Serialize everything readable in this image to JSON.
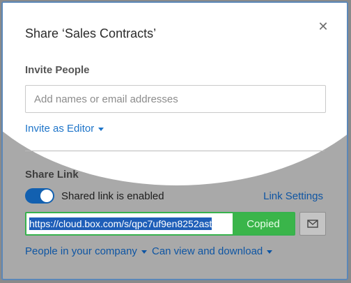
{
  "dialog": {
    "title": "Share ‘Sales Contracts’",
    "close_icon": "close-icon"
  },
  "invite": {
    "heading": "Invite People",
    "input_placeholder": "Add names or email addresses",
    "input_value": "",
    "role_dropdown": "Invite as Editor"
  },
  "share_link": {
    "heading": "Share Link",
    "toggle_on": true,
    "toggle_label": "Shared link is enabled",
    "settings_link": "Link Settings",
    "url": "https://cloud.box.com/s/qpc7uf9en8252ast",
    "copied_button": "Copied",
    "email_icon": "envelope-icon",
    "access_dropdown": "People in your company",
    "permission_dropdown": "Can view and download"
  },
  "colors": {
    "link_blue": "#1d74c9",
    "toggle_blue": "#1260b0",
    "copied_green": "#3ab54a",
    "highlight_blue": "#1e5eb8"
  }
}
